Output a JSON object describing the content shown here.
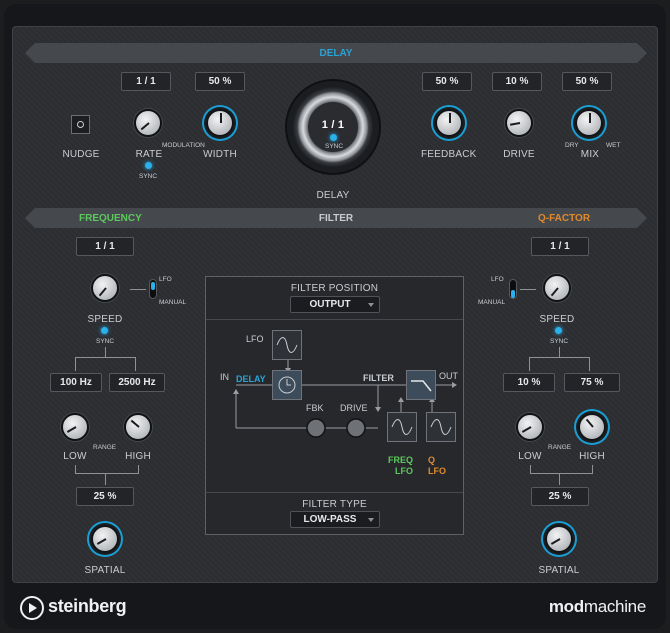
{
  "delay": {
    "header": "DELAY",
    "nudge_label": "NUDGE",
    "rate_value": "1 / 1",
    "rate_label": "RATE",
    "rate_sync": "SYNC",
    "modulation_label": "MODULATION",
    "width_value": "50 %",
    "width_label": "WIDTH",
    "main_value": "1 / 1",
    "main_sync": "SYNC",
    "main_label": "DELAY",
    "feedback_value": "50 %",
    "feedback_label": "FEEDBACK",
    "drive_value": "10 %",
    "drive_label": "DRIVE",
    "mix_value": "50 %",
    "mix_label": "MIX",
    "mix_dry": "DRY",
    "mix_wet": "WET"
  },
  "filter": {
    "header": "FILTER",
    "frequency_header": "FREQUENCY",
    "qfactor_header": "Q-FACTOR",
    "freq": {
      "rate_value": "1 / 1",
      "lfo_label": "LFO",
      "manual_label": "MANUAL",
      "speed_label": "SPEED",
      "sync_label": "SYNC",
      "low_value": "100 Hz",
      "high_value": "2500 Hz",
      "range_label": "RANGE",
      "low_label": "LOW",
      "high_label": "HIGH",
      "spatial_value": "25 %",
      "spatial_label": "SPATIAL"
    },
    "q": {
      "rate_value": "1 / 1",
      "lfo_label": "LFO",
      "manual_label": "MANUAL",
      "speed_label": "SPEED",
      "sync_label": "SYNC",
      "low_value": "10 %",
      "high_value": "75 %",
      "range_label": "RANGE",
      "low_label": "LOW",
      "high_label": "HIGH",
      "spatial_value": "25 %",
      "spatial_label": "SPATIAL"
    },
    "diagram": {
      "position_label": "FILTER POSITION",
      "position_value": "OUTPUT",
      "type_label": "FILTER TYPE",
      "type_value": "LOW-PASS",
      "lfo": "LFO",
      "in": "IN",
      "delay": "DELAY",
      "filter": "FILTER",
      "out": "OUT",
      "fbk": "FBK",
      "drive": "DRIVE",
      "freq": "FREQ",
      "freq_lfo": "LFO",
      "q": "Q",
      "q_lfo": "LFO"
    }
  },
  "footer": {
    "brand": "steinberg",
    "product_bold": "mod",
    "product_light": "machine"
  },
  "colors": {
    "accent_blue": "#1a9fd4",
    "frequency_green": "#5cc95c",
    "qfactor_orange": "#e08a2c"
  },
  "icons": [
    "nudge-icon",
    "steinberg-logo-icon",
    "lfo-sine-icon",
    "delay-time-icon",
    "lowpass-filter-icon"
  ]
}
